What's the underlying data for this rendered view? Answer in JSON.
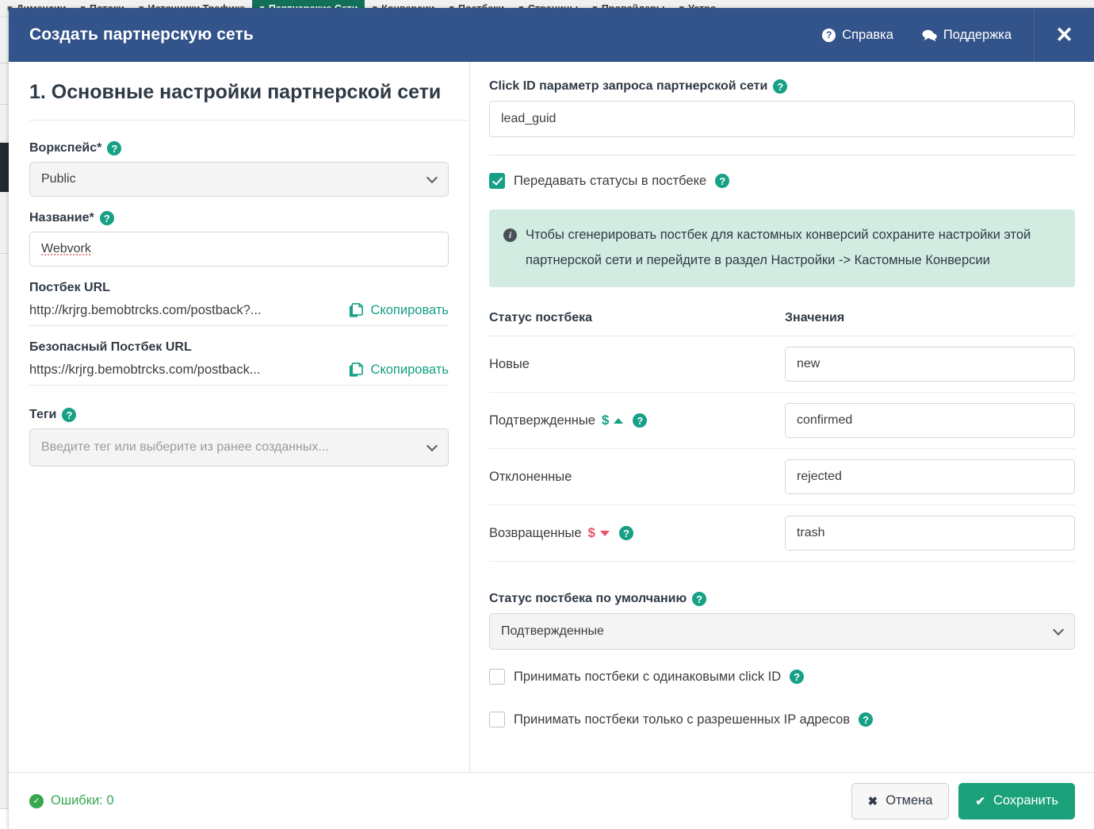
{
  "background_nav": {
    "items": [
      {
        "label": "Дименсии",
        "icon": "grid-icon",
        "active": false
      },
      {
        "label": "Потоки",
        "icon": "flow-icon",
        "active": false
      },
      {
        "label": "Источники Трафика",
        "icon": "chart-icon",
        "active": false
      },
      {
        "label": "Партнерские Сети",
        "icon": "network-icon",
        "active": true
      },
      {
        "label": "Конверсии",
        "icon": "cursor-icon",
        "active": false
      },
      {
        "label": "Постбеки",
        "icon": "bell-icon",
        "active": false
      },
      {
        "label": "Страницы",
        "icon": "page-icon",
        "active": false
      },
      {
        "label": "Провайдеры",
        "icon": "cloud-icon",
        "active": false
      },
      {
        "label": "Устро",
        "icon": "device-icon",
        "active": false
      }
    ]
  },
  "header": {
    "title": "Создать партнерскую сеть",
    "help_label": "Справка",
    "support_label": "Поддержка",
    "close_glyph": "✕",
    "bg_color": "#33548a"
  },
  "left": {
    "step_title": "1. Основные настройки партнерской сети",
    "workspace": {
      "label": "Воркспейс*",
      "value": "Public"
    },
    "name": {
      "label": "Название*",
      "value": "Webvork"
    },
    "postback_url": {
      "label": "Постбек URL",
      "value": "http://krjrg.bemobtrcks.com/postback?...",
      "copy_label": "Скопировать"
    },
    "secure_postback_url": {
      "label": "Безопасный Постбек URL",
      "value": "https://krjrg.bemobtrcks.com/postback...",
      "copy_label": "Скопировать"
    },
    "tags": {
      "label": "Теги",
      "placeholder": "Введите тег или выберите из ранее созданных...",
      "value": ""
    }
  },
  "right": {
    "click_id": {
      "label": "Click ID параметр запроса партнерской сети",
      "value": "lead_guid"
    },
    "pass_statuses": {
      "label": "Передавать статусы в постбеке",
      "checked": true
    },
    "info_note": "Чтобы сгенерировать постбек для кастомных конверсий сохраните настройки этой партнерской сети и перейдите в раздел Настройки -> Кастомные Конверсии",
    "table": {
      "headers": [
        "Статус постбека",
        "Значения"
      ],
      "rows": [
        {
          "status": "Новые",
          "value": "new",
          "money": null,
          "help": false
        },
        {
          "status": "Подтвержденные",
          "value": "confirmed",
          "money": "up",
          "help": true
        },
        {
          "status": "Отклоненные",
          "value": "rejected",
          "money": null,
          "help": false
        },
        {
          "status": "Возвращенные",
          "value": "trash",
          "money": "down",
          "help": true
        }
      ]
    },
    "default_status": {
      "label": "Статус постбека по умолчанию",
      "value": "Подтвержденные"
    },
    "same_clickid": {
      "label": "Принимать постбеки с одинаковыми click ID",
      "checked": false
    },
    "allowed_ip": {
      "label": "Принимать постбеки только с разрешенных IP адресов",
      "checked": false
    }
  },
  "footer": {
    "errors_label": "Ошибки: 0",
    "errors_color": "#36a64f",
    "cancel_label": "Отмена",
    "cancel_glyph": "✖",
    "save_label": "Сохранить",
    "save_glyph": "✔",
    "save_color": "#1aa179"
  },
  "help_glyph": "?"
}
